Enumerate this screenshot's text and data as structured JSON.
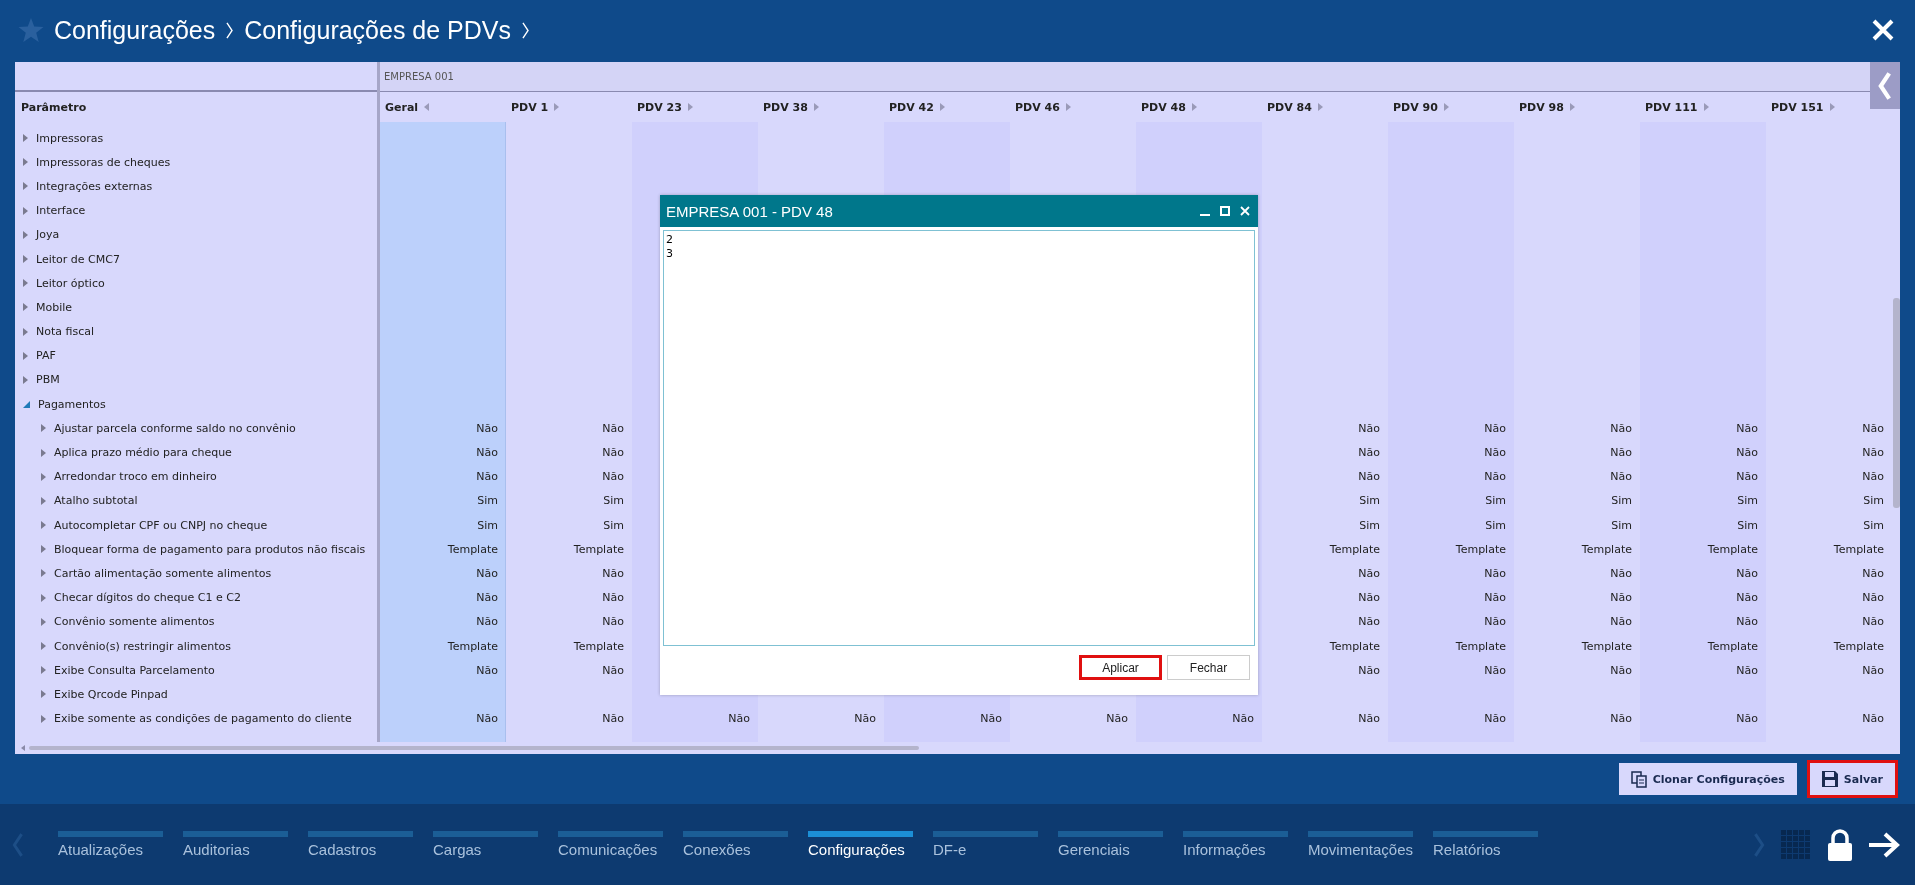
{
  "breadcrumb": [
    "Configurações",
    "Configurações de PDVs"
  ],
  "table": {
    "group": "EMPRESA 001",
    "param_header": "Parâmetro",
    "columns": [
      {
        "label": "Geral",
        "selected": true,
        "expanded": true
      },
      {
        "label": "PDV 1",
        "selected": false,
        "expanded": false
      },
      {
        "label": "PDV 23",
        "selected": false,
        "expanded": false
      },
      {
        "label": "PDV 38",
        "selected": false,
        "expanded": false
      },
      {
        "label": "PDV 42",
        "selected": false,
        "expanded": false
      },
      {
        "label": "PDV 46",
        "selected": false,
        "expanded": false
      },
      {
        "label": "PDV 48",
        "selected": false,
        "expanded": false
      },
      {
        "label": "PDV 84",
        "selected": false,
        "expanded": false
      },
      {
        "label": "PDV 90",
        "selected": false,
        "expanded": false
      },
      {
        "label": "PDV 98",
        "selected": false,
        "expanded": false
      },
      {
        "label": "PDV 111",
        "selected": false,
        "expanded": false
      },
      {
        "label": "PDV 151",
        "selected": false,
        "expanded": false
      }
    ],
    "rows": [
      {
        "label": "Impressoras",
        "expanded": false
      },
      {
        "label": "Impressoras de cheques",
        "expanded": false
      },
      {
        "label": "Integrações externas",
        "expanded": false
      },
      {
        "label": "Interface",
        "expanded": false
      },
      {
        "label": "Joya",
        "expanded": false
      },
      {
        "label": "Leitor de CMC7",
        "expanded": false
      },
      {
        "label": "Leitor óptico",
        "expanded": false
      },
      {
        "label": "Mobile",
        "expanded": false
      },
      {
        "label": "Nota fiscal",
        "expanded": false
      },
      {
        "label": "PAF",
        "expanded": false
      },
      {
        "label": "PBM",
        "expanded": false
      },
      {
        "label": "Pagamentos",
        "expanded": true,
        "children": [
          {
            "label": "Ajustar parcela conforme saldo no convênio",
            "expanded": false,
            "values_left": [
              "Não",
              "Não"
            ],
            "values_right": [
              "Não",
              "Não",
              "Não",
              "Não",
              "Não"
            ]
          },
          {
            "label": "Aplica prazo médio para cheque",
            "expanded": false,
            "values_left": [
              "Não",
              "Não"
            ],
            "values_right": [
              "Não",
              "Não",
              "Não",
              "Não",
              "Não"
            ]
          },
          {
            "label": "Arredondar troco em dinheiro",
            "expanded": false,
            "values_left": [
              "Não",
              "Não"
            ],
            "values_right": [
              "Não",
              "Não",
              "Não",
              "Não",
              "Não"
            ]
          },
          {
            "label": "Atalho subtotal",
            "expanded": false,
            "values_left": [
              "Sim",
              "Sim"
            ],
            "values_right": [
              "Sim",
              "Sim",
              "Sim",
              "Sim",
              "Sim"
            ]
          },
          {
            "label": "Autocompletar CPF ou CNPJ no cheque",
            "expanded": false,
            "values_left": [
              "Sim",
              "Sim"
            ],
            "values_right": [
              "Sim",
              "Sim",
              "Sim",
              "Sim",
              "Sim"
            ]
          },
          {
            "label": "Bloquear forma de pagamento para produtos não fiscais",
            "expanded": false,
            "values_left": [
              "Template",
              "Template"
            ],
            "values_right": [
              "Template",
              "Template",
              "Template",
              "Template",
              "Template"
            ]
          },
          {
            "label": "Cartão alimentação somente alimentos",
            "expanded": false,
            "values_left": [
              "Não",
              "Não"
            ],
            "values_right": [
              "Não",
              "Não",
              "Não",
              "Não",
              "Não"
            ]
          },
          {
            "label": "Checar dígitos do cheque C1 e C2",
            "expanded": false,
            "values_left": [
              "Não",
              "Não"
            ],
            "values_right": [
              "Não",
              "Não",
              "Não",
              "Não",
              "Não"
            ]
          },
          {
            "label": "Convênio somente alimentos",
            "expanded": false,
            "values_left": [
              "Não",
              "Não"
            ],
            "values_right": [
              "Não",
              "Não",
              "Não",
              "Não",
              "Não"
            ]
          },
          {
            "label": "Convênio(s) restringir alimentos",
            "expanded": false,
            "values_left": [
              "Template",
              "Template"
            ],
            "values_right": [
              "Template",
              "Template",
              "Template",
              "Template",
              "Template"
            ]
          },
          {
            "label": "Exibe Consulta Parcelamento",
            "expanded": false,
            "values_left": [
              "Não",
              "Não"
            ],
            "values_right": [
              "Não",
              "Não",
              "Não",
              "Não",
              "Não"
            ]
          },
          {
            "label": "Exibe Qrcode Pinpad",
            "expanded": false
          },
          {
            "label": "Exibe somente as condições de pagamento do cliente",
            "expanded": false,
            "values_left": [
              "Não",
              "Não",
              "Não",
              "Não",
              "Não",
              "Não",
              "Não",
              "Não",
              "Não",
              "Não",
              "Não",
              "Não"
            ]
          }
        ]
      }
    ]
  },
  "dialog": {
    "title": "EMPRESA 001 - PDV 48",
    "value": "2\n3",
    "buttons": [
      {
        "label": "Aplicar",
        "highlighted": true
      },
      {
        "label": "Fechar",
        "highlighted": false
      }
    ]
  },
  "actions": [
    {
      "label": "Clonar Configurações",
      "kind": "clone",
      "highlighted": false
    },
    {
      "label": "Salvar",
      "kind": "save",
      "highlighted": true
    }
  ],
  "nav": [
    {
      "label": "Atualizações",
      "selected": false
    },
    {
      "label": "Auditorias",
      "selected": false
    },
    {
      "label": "Cadastros",
      "selected": false
    },
    {
      "label": "Cargas",
      "selected": false
    },
    {
      "label": "Comunicações",
      "selected": false
    },
    {
      "label": "Conexões",
      "selected": false
    },
    {
      "label": "Configurações",
      "selected": true
    },
    {
      "label": "DF-e",
      "selected": false
    },
    {
      "label": "Gerenciais",
      "selected": false
    },
    {
      "label": "Informações",
      "selected": false
    },
    {
      "label": "Movimentações",
      "selected": false
    },
    {
      "label": "Relatórios",
      "selected": false
    }
  ]
}
